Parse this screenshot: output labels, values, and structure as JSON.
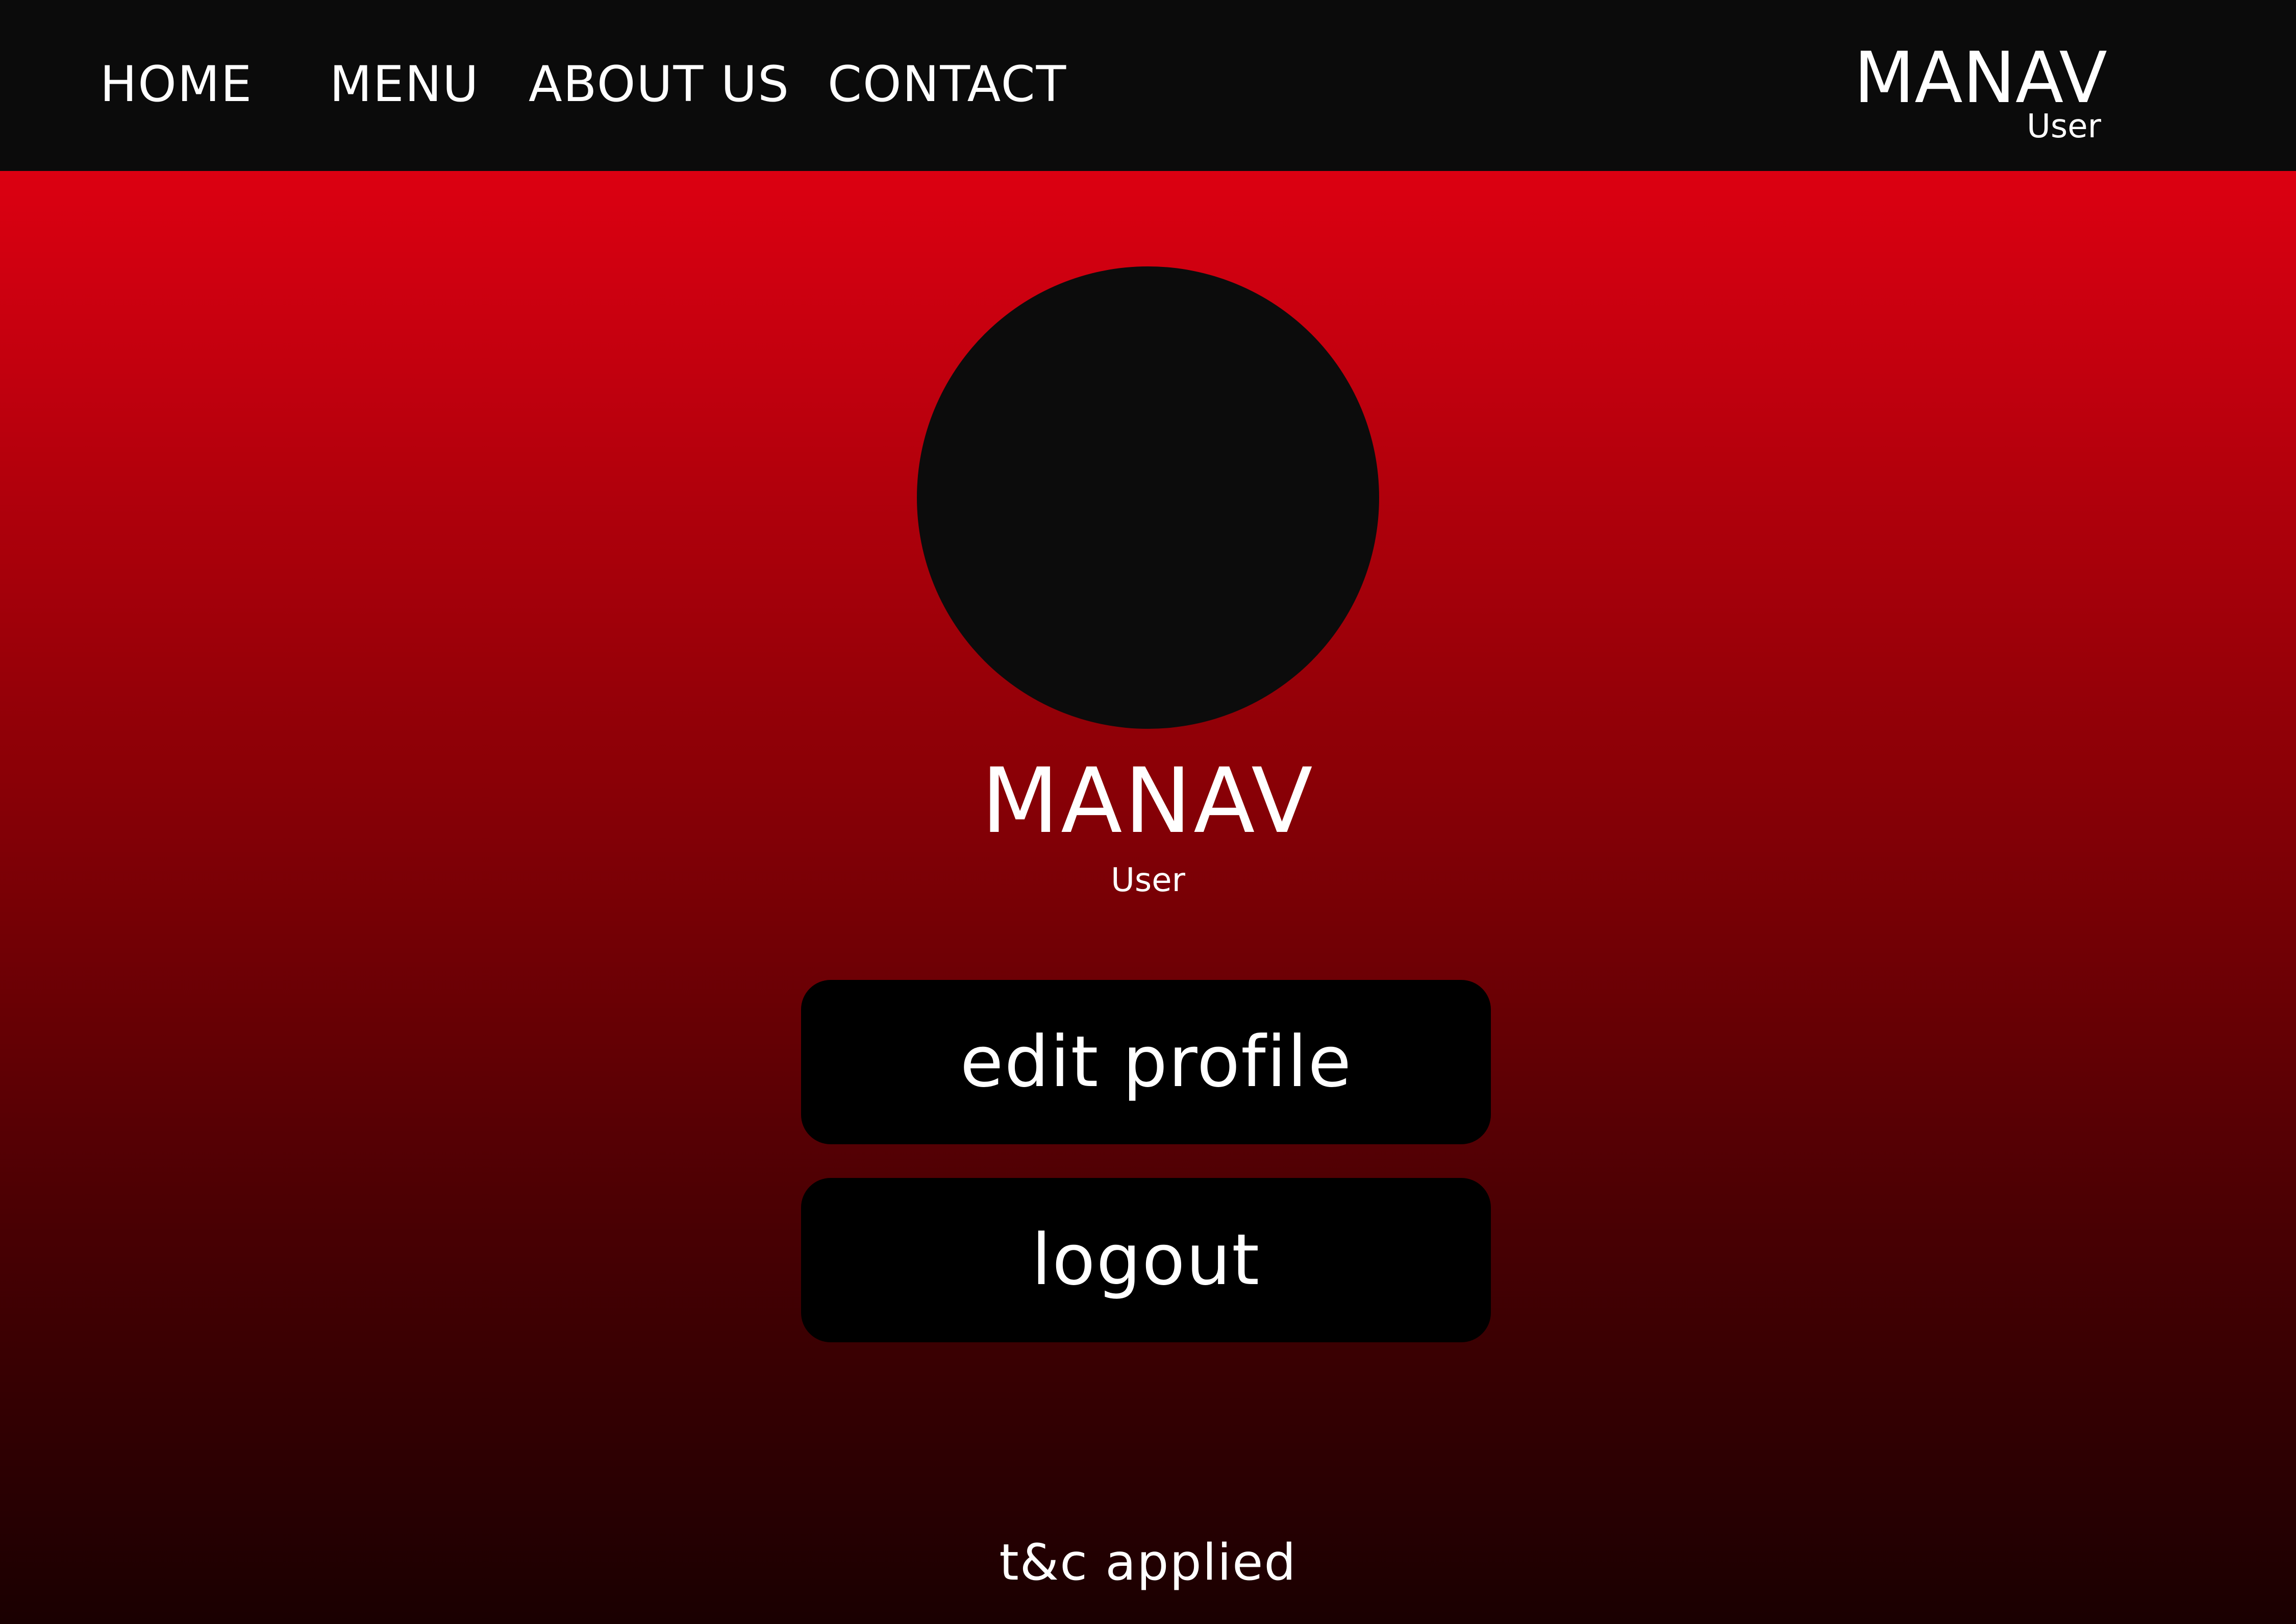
{
  "nav": {
    "items": [
      {
        "label": "HOME"
      },
      {
        "label": "MENU"
      },
      {
        "label": "ABOUT US"
      },
      {
        "label": "CONTACT"
      }
    ]
  },
  "user_badge": {
    "name": "MANAV",
    "role": "User"
  },
  "profile": {
    "name": "MANAV",
    "role": "User"
  },
  "actions": {
    "edit_label": "edit profile",
    "logout_label": "logout"
  },
  "footer": {
    "note": "t&c applied"
  },
  "colors": {
    "topbar": "#0b0b0b",
    "gradient_top": "#f20014",
    "gradient_bottom": "#1a0001",
    "avatar": "#0c0c0c",
    "button": "#000000",
    "text": "#ffffff"
  }
}
